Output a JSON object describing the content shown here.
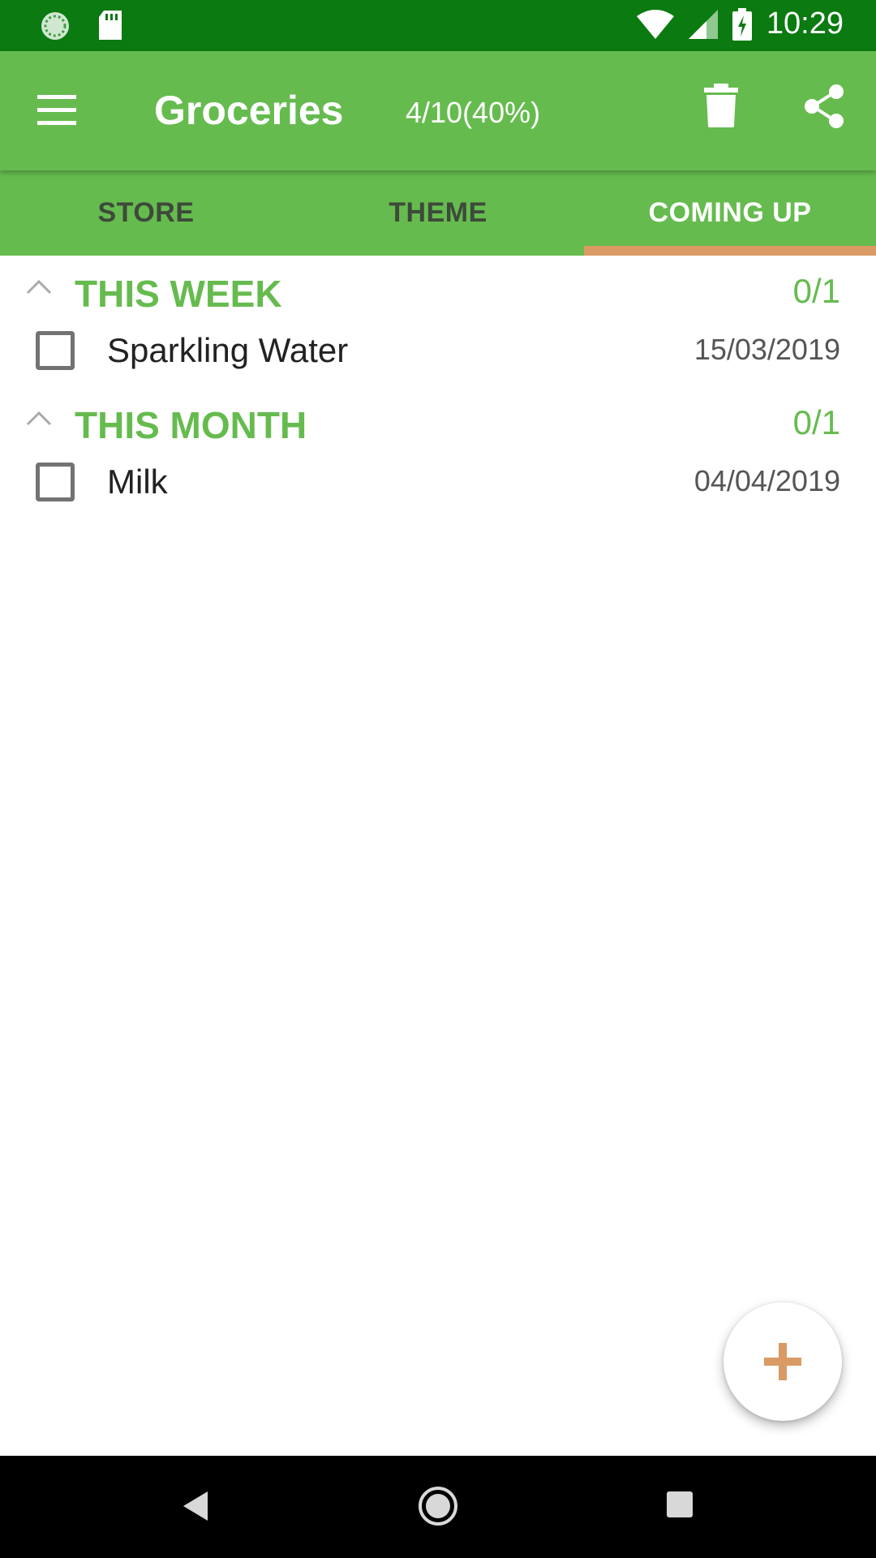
{
  "status_bar": {
    "time": "10:29",
    "icons": [
      "sync-icon",
      "sd-card-icon",
      "wifi-icon",
      "signal-icon",
      "battery-charging-icon"
    ]
  },
  "app_bar": {
    "title": "Groceries",
    "progress": "4/10(40%)",
    "icons": [
      "menu-icon",
      "trash-icon",
      "share-icon"
    ]
  },
  "tabs": [
    {
      "label": "STORE",
      "active": false
    },
    {
      "label": "THEME",
      "active": false
    },
    {
      "label": "COMING UP",
      "active": true
    }
  ],
  "sections": [
    {
      "title": "THIS WEEK",
      "count": "0/1",
      "items": [
        {
          "name": "Sparkling Water",
          "date": "15/03/2019",
          "checked": false
        }
      ]
    },
    {
      "title": "THIS MONTH",
      "count": "0/1",
      "items": [
        {
          "name": "Milk",
          "date": "04/04/2019",
          "checked": false
        }
      ]
    }
  ],
  "fab": {
    "icon": "add-icon"
  },
  "nav_bar": {
    "icons": [
      "back-icon",
      "home-icon",
      "recents-icon"
    ]
  },
  "colors": {
    "status_bar": "#0a7a11",
    "app_bar": "#66bb4f",
    "accent": "#d99a64",
    "section_text": "#66bb4f"
  }
}
